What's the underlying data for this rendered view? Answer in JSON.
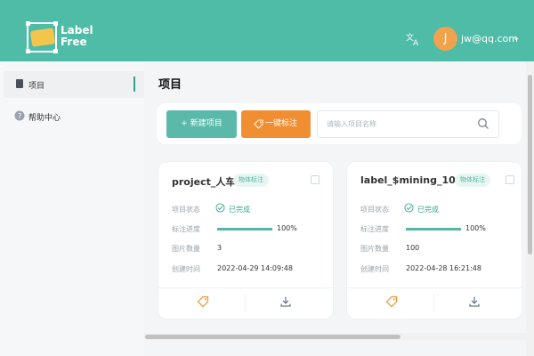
{
  "header": {
    "brand_line1": "Label",
    "brand_line2": "Free",
    "user_initial": "J",
    "user_email": "jw@qq.com",
    "translate_icon": "translate-icon",
    "dropdown_icon": "chevron-down-icon"
  },
  "sidebar": {
    "items": [
      {
        "label": "项目",
        "icon": "document-icon"
      },
      {
        "label": "帮助中心",
        "icon": "help-icon"
      }
    ]
  },
  "main": {
    "title": "项目",
    "toolbar": {
      "new_button": "+ 新建项目",
      "onekey_button": "一键标注",
      "search_placeholder": "请输入项目名称"
    },
    "cards": [
      {
        "title": "project_人车",
        "tag": "物体标注",
        "status_label": "项目状态",
        "status_value": "已完成",
        "progress_label": "标注进度",
        "progress_value": "100%",
        "progress_fraction": 1,
        "count_label": "图片数量",
        "count_value": "3",
        "time_label": "创建时间",
        "time_value": "2022-04-29 14:09:48"
      },
      {
        "title": "label_$mining_10...",
        "tag": "物体标注",
        "status_label": "项目状态",
        "status_value": "已完成",
        "progress_label": "标注进度",
        "progress_value": "100%",
        "progress_fraction": 1,
        "count_label": "图片数量",
        "count_value": "100",
        "time_label": "创建时间",
        "time_value": "2022-04-28 16:21:48"
      }
    ]
  },
  "colors": {
    "primary": "#4fbca7",
    "accent": "#f18e31",
    "avatar": "#f0a24c"
  }
}
